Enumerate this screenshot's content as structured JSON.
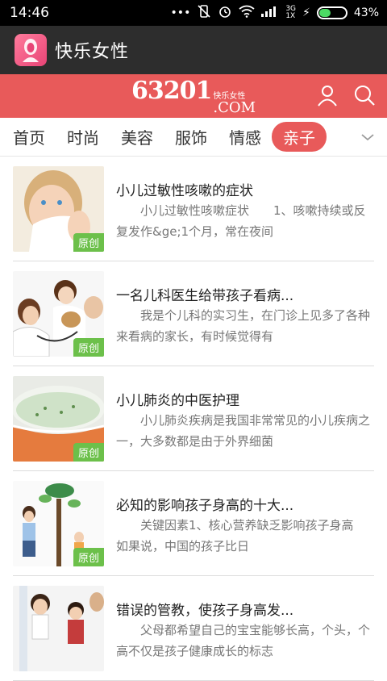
{
  "status_bar": {
    "time": "14:46",
    "network": "3G",
    "network_sub": "1X",
    "battery": "43%",
    "battery_level": 0.43
  },
  "app": {
    "title": "快乐女性",
    "logo_icon": "woman-silhouette-icon"
  },
  "brand": {
    "number": "63201",
    "cn": "快乐女性",
    "com": ".COM"
  },
  "tabs": [
    {
      "label": "首页",
      "active": false
    },
    {
      "label": "时尚",
      "active": false
    },
    {
      "label": "美容",
      "active": false
    },
    {
      "label": "服饰",
      "active": false
    },
    {
      "label": "情感",
      "active": false
    },
    {
      "label": "亲子",
      "active": true
    }
  ],
  "articles": [
    {
      "title": "小儿过敏性咳嗽的症状",
      "summary": "　　小儿过敏性咳嗽症状　　1、咳嗽持续或反复发作&ge;1个月，常在夜间",
      "badge": "原创",
      "image_icon": "child-with-tissue-image"
    },
    {
      "title": "一名儿科医生给带孩子看病...",
      "summary": "　　我是个儿科的实习生，在门诊上见多了各种来看病的家长，有时候觉得有",
      "badge": "原创",
      "image_icon": "doctor-with-child-image"
    },
    {
      "title": "小儿肺炎的中医护理",
      "summary": "　　小儿肺炎疾病是我国非常常见的小儿疾病之一，大多数都是由于外界细菌",
      "badge": "原创",
      "image_icon": "vegetable-porridge-bowl-image"
    },
    {
      "title": "必知的影响孩子身高的十大...",
      "summary": "　　关键因素1、核心营养缺乏影响孩子身高　　如果说，中国的孩子比日",
      "badge": "原创",
      "image_icon": "kids-height-chart-image"
    },
    {
      "title": "错误的管教，使孩子身高发...",
      "summary": "　　父母都希望自己的宝宝能够长高，个头，个高不仅是孩子健康成长的标志",
      "badge": "",
      "image_icon": "kids-measuring-height-image"
    }
  ]
}
